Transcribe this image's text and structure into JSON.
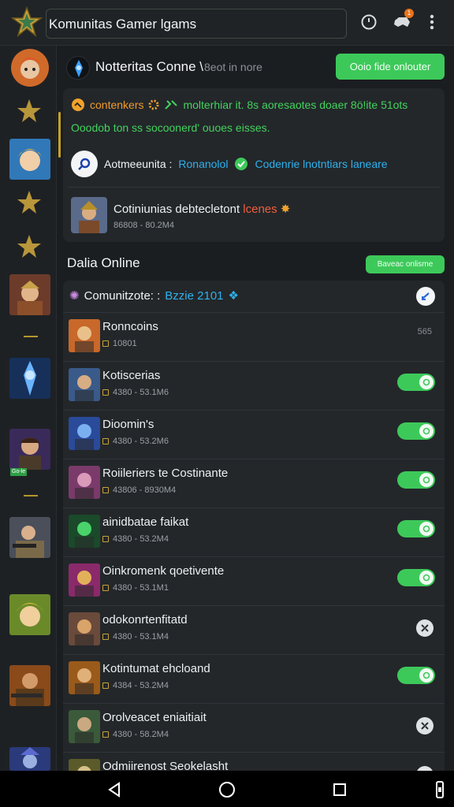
{
  "topbar": {
    "search_value": "Komunitas Gamer lgams",
    "icons": [
      "app-logo-star",
      "timer-icon",
      "game-controller-icon",
      "more-vert-icon"
    ],
    "badge": "1"
  },
  "sidebar": {
    "tag": "Go-le"
  },
  "header": {
    "title": "Notteritas Conne \\",
    "subtitle": "8eot in nore",
    "button": "Ooio fide onlouter"
  },
  "info_card": {
    "row1_left": "contenkers",
    "row1_right": "molterhiar it. 8s aoresaotes doaer 8ö!ite 51ots",
    "row2": "Ooodob ton ss socoonerd' ouoes eisses.",
    "row3_label": "Aotmeeunita :",
    "row3_value": "Ronanolol",
    "row3_link": "Codenrie lnotntiars laneare",
    "row4_title": "Cotiniunias debtecletont",
    "row4_hot": "lcenes",
    "row4_meta": "86808 - 80.2M4"
  },
  "section": {
    "title": "Dalia Online",
    "button": "Baveac onlisme"
  },
  "list_header": {
    "label": "Comunitzote: :",
    "value": "Bzzie 2101"
  },
  "items": [
    {
      "name": "Ronncoins",
      "meta": "10801",
      "action": "text",
      "side_text": "565"
    },
    {
      "name": "Kotiscerias",
      "meta": "4380 - 53.1M6",
      "action": "toggle"
    },
    {
      "name": "Dioomin's",
      "meta": "4380 - 53.2M6",
      "action": "toggle"
    },
    {
      "name": "Roiileriers te Costinante",
      "meta": "43806 - 8930M4",
      "action": "toggle"
    },
    {
      "name": "ainidbatae faikat",
      "meta": "4380 - 53.2M4",
      "action": "toggle"
    },
    {
      "name": "Oinkromenk qoetivente",
      "meta": "4380 - 53.1M1",
      "action": "toggle"
    },
    {
      "name": "odokonrtenfitatd",
      "meta": "4380 - 53.1M4",
      "action": "round"
    },
    {
      "name": "Kotintumat ehcloand",
      "meta": "4384 - 53.2M4",
      "action": "toggle"
    },
    {
      "name": "Orolveacet eniaitiait",
      "meta": "4380 - 58.2M4",
      "action": "round"
    },
    {
      "name": "Odmiirenost Seokelasht",
      "meta": "",
      "action": "round"
    }
  ],
  "colors": {
    "accent_green": "#3dc95a",
    "accent_orange": "#f19a2a",
    "accent_blue": "#2fb1ee",
    "background": "#1b1e21",
    "card": "#23272a"
  }
}
